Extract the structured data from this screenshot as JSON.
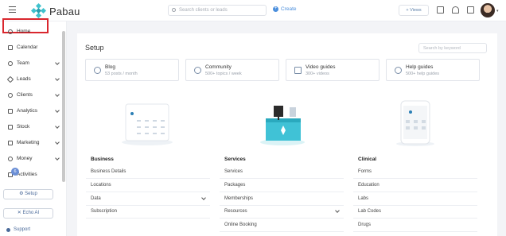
{
  "topbar": {
    "logo_text": "Pabau",
    "search_placeholder": "Search clients or leads",
    "create_label": "Create",
    "views_label": "+ Views"
  },
  "sidebar": {
    "items": [
      {
        "label": "Home",
        "icon": "clock-icon",
        "chevron": false
      },
      {
        "label": "Calendar",
        "icon": "calendar-icon",
        "chevron": false
      },
      {
        "label": "Team",
        "icon": "team-icon",
        "chevron": true
      },
      {
        "label": "Leads",
        "icon": "leads-icon",
        "chevron": true
      },
      {
        "label": "Clients",
        "icon": "clients-icon",
        "chevron": true
      },
      {
        "label": "Analytics",
        "icon": "analytics-icon",
        "chevron": true
      },
      {
        "label": "Stock",
        "icon": "stock-icon",
        "chevron": true
      },
      {
        "label": "Marketing",
        "icon": "marketing-icon",
        "chevron": true
      },
      {
        "label": "Money",
        "icon": "money-icon",
        "chevron": true
      },
      {
        "label": "Activities",
        "icon": "activities-icon",
        "chevron": false
      }
    ],
    "activities_badge": "6",
    "setup_button": "Setup",
    "echo_button": "Echo AI",
    "support_label": "Support"
  },
  "main": {
    "title": "Setup",
    "search_placeholder": "Search by keyword",
    "cards": [
      {
        "title": "Blog",
        "subtitle": "53 posts / month"
      },
      {
        "title": "Community",
        "subtitle": "500+ topics / week"
      },
      {
        "title": "Video guides",
        "subtitle": "300+ videos"
      },
      {
        "title": "Help guides",
        "subtitle": "500+ help guides"
      }
    ],
    "sections": [
      {
        "title": "Business",
        "items": [
          "Business Details",
          "Locations",
          "Data",
          "Subscription"
        ]
      },
      {
        "title": "Services",
        "items": [
          "Services",
          "Packages",
          "Memberships",
          "Resources",
          "Online Booking"
        ]
      },
      {
        "title": "Clinical",
        "items": [
          "Forms",
          "Education",
          "Labs",
          "Lab Codes",
          "Drugs"
        ]
      }
    ]
  },
  "colors": {
    "accent": "#3fc2cd",
    "highlight": "#d9272e",
    "link": "#4b8fdd"
  }
}
